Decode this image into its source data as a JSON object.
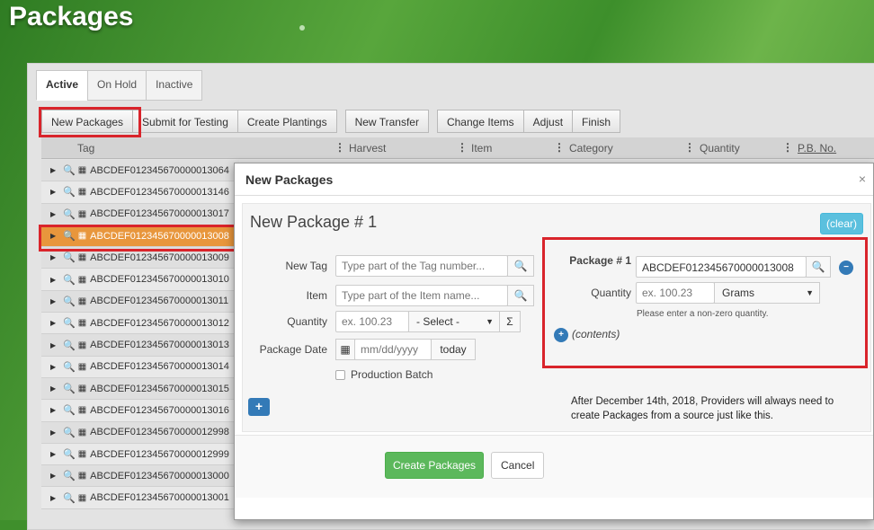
{
  "page": {
    "title": "Packages"
  },
  "tabs": [
    "Active",
    "On Hold",
    "Inactive"
  ],
  "toolbar": {
    "new_packages": "New Packages",
    "submit_testing": "Submit for Testing",
    "create_plantings": "Create Plantings",
    "new_transfer": "New Transfer",
    "change_items": "Change Items",
    "adjust": "Adjust",
    "finish": "Finish"
  },
  "grid": {
    "columns": {
      "tag": "Tag",
      "harvest": "Harvest",
      "item": "Item",
      "category": "Category",
      "quantity": "Quantity",
      "pb_no": "P.B. No."
    },
    "rows": [
      "ABCDEF012345670000013064",
      "ABCDEF012345670000013146",
      "ABCDEF012345670000013017",
      "ABCDEF012345670000013008",
      "ABCDEF012345670000013009",
      "ABCDEF012345670000013010",
      "ABCDEF012345670000013011",
      "ABCDEF012345670000013012",
      "ABCDEF012345670000013013",
      "ABCDEF012345670000013014",
      "ABCDEF012345670000013015",
      "ABCDEF012345670000013016",
      "ABCDEF012345670000012998",
      "ABCDEF012345670000012999",
      "ABCDEF012345670000013000",
      "ABCDEF012345670000013001"
    ]
  },
  "modal": {
    "title": "New Packages",
    "close": "×",
    "package_title": "New Package # 1",
    "clear": "(clear)",
    "new_tag_label": "New Tag",
    "new_tag_placeholder": "Type part of the Tag number...",
    "item_label": "Item",
    "item_placeholder": "Type part of the Item name...",
    "quantity_label": "Quantity",
    "quantity_placeholder": "ex. 100.23",
    "uom_select": "- Select -",
    "sigma": "Σ",
    "package_date_label": "Package Date",
    "date_placeholder": "mm/dd/yyyy",
    "today": "today",
    "production_batch": "Production Batch",
    "source": {
      "package_label": "Package # 1",
      "package_value": "ABCDEF012345670000013008",
      "quantity_label": "Quantity",
      "quantity_placeholder": "ex. 100.23",
      "unit": "Grams",
      "validation": "Please enter a non-zero quantity.",
      "contents": "(contents)"
    },
    "note": "After December 14th, 2018, Providers will always need to create Packages from a source just like this.",
    "create_button": "Create Packages",
    "cancel_button": "Cancel"
  },
  "colors": {
    "highlight": "#d9242b",
    "selected_row": "#e8963c",
    "create_button": "#5cb85c",
    "clear_button": "#5bc0de"
  }
}
